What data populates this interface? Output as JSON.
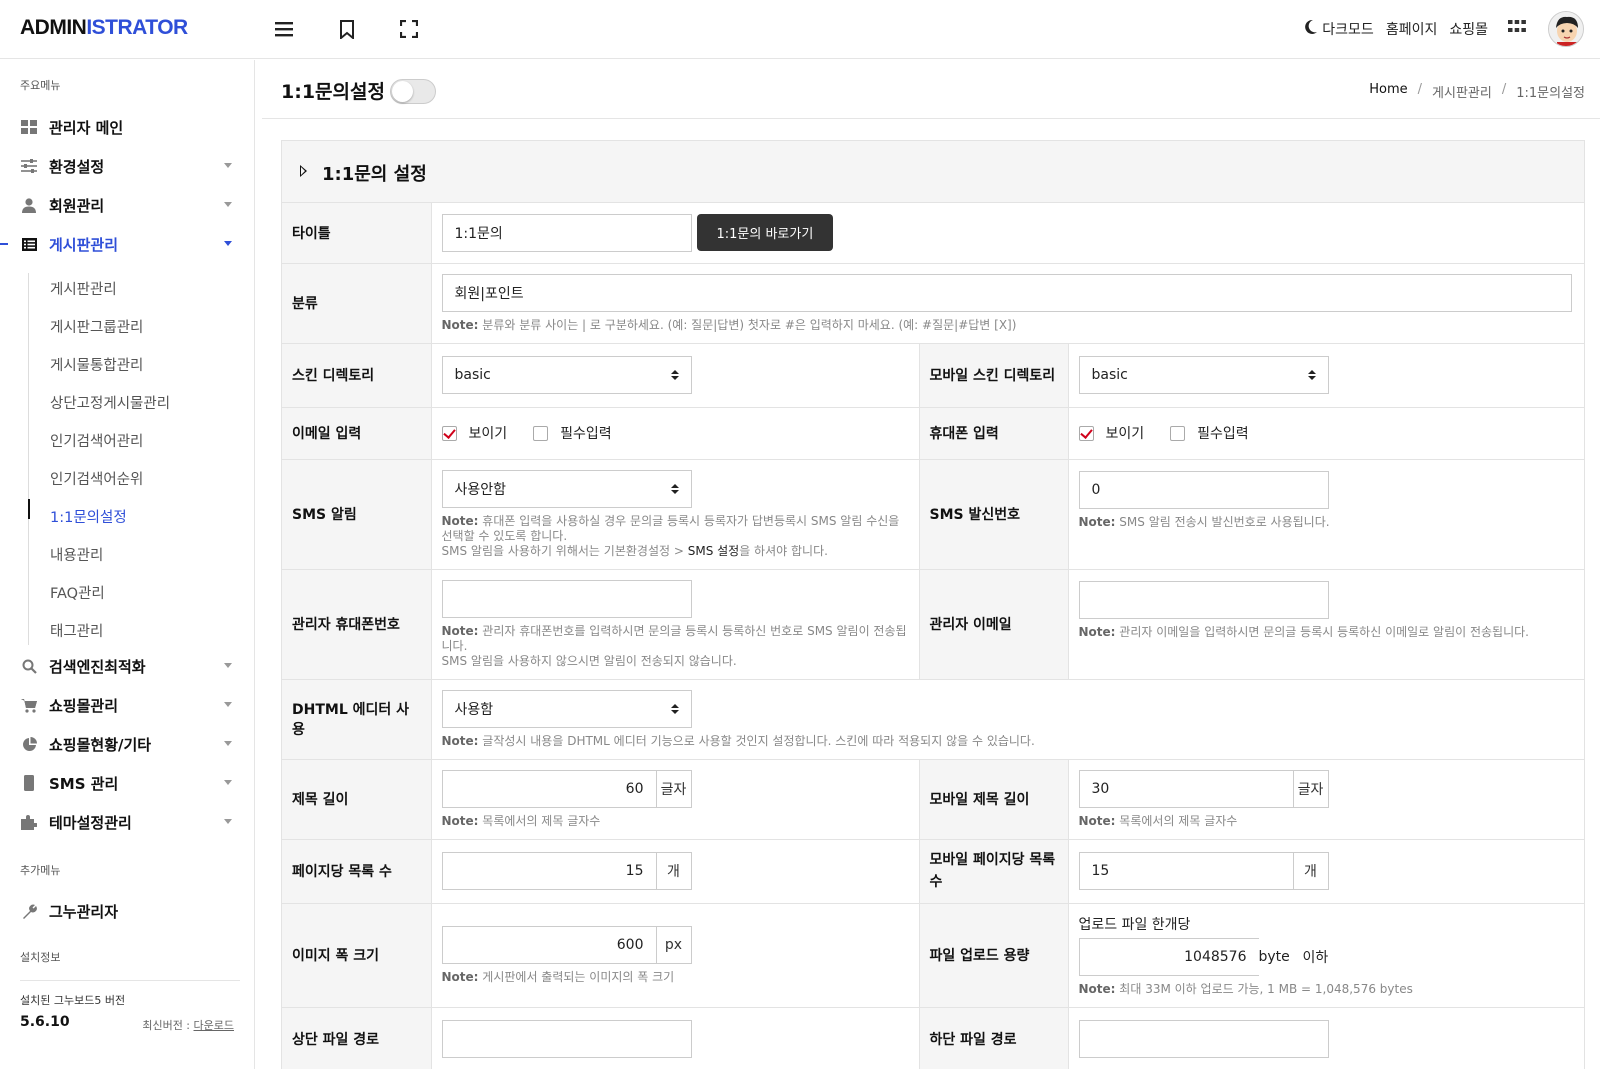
{
  "header": {
    "logo_part1": "ADMIN",
    "logo_part2": "ISTRATOR",
    "dark_mode": "다크모드",
    "homepage": "홈페이지",
    "shop": "쇼핑몰",
    "icons": [
      "menu-icon",
      "bookmark-icon",
      "fullscreen-icon",
      "moon-icon",
      "apps-grid-icon"
    ]
  },
  "sidebar": {
    "section_main": "주요메뉴",
    "items": [
      {
        "label": "관리자 메인",
        "icon": "dashboard-icon"
      },
      {
        "label": "환경설정",
        "icon": "sliders-icon"
      },
      {
        "label": "회원관리",
        "icon": "user-icon"
      },
      {
        "label": "게시판관리",
        "icon": "list-icon"
      },
      {
        "label": "검색엔진최적화",
        "icon": "search-icon"
      },
      {
        "label": "쇼핑몰관리",
        "icon": "cart-icon"
      },
      {
        "label": "쇼핑몰현황/기타",
        "icon": "pie-chart-icon"
      },
      {
        "label": "SMS 관리",
        "icon": "phone-icon"
      },
      {
        "label": "테마설정관리",
        "icon": "puzzle-icon"
      }
    ],
    "sub_items": [
      "게시판관리",
      "게시판그룹관리",
      "게시물통합관리",
      "상단고정게시물관리",
      "인기검색어관리",
      "인기검색어순위",
      "1:1문의설정",
      "내용관리",
      "FAQ관리",
      "태그관리"
    ],
    "section_extra": "추가메뉴",
    "extra_item": "그누관리자",
    "section_install": "설치정보",
    "version_label": "설치된 그누보드5 버전",
    "version": "5.6.10",
    "latest_label": "최신버전 :",
    "latest_link": "다운로드"
  },
  "page": {
    "title": "1:1문의설정",
    "breadcrumb": [
      "Home",
      "게시판관리",
      "1:1문의설정"
    ],
    "panel_title": "1:1문의 설정"
  },
  "form": {
    "title_label": "타이틀",
    "title_value": "1:1문의",
    "title_button": "1:1문의 바로가기",
    "category_label": "분류",
    "category_value": "회원|포인트",
    "category_note_b": "Note:",
    "category_note": "분류와 분류 사이는 | 로 구분하세요. (예: 질문|답변) 첫자로 #은 입력하지 마세요. (예: #질문|#답변 [X])",
    "skin_label": "스킨 디렉토리",
    "skin_value": "basic",
    "mskin_label": "모바일 스킨 디렉토리",
    "mskin_value": "basic",
    "email_label": "이메일 입력",
    "phone_label": "휴대폰 입력",
    "show": "보이기",
    "required": "필수입력",
    "sms_label": "SMS 알림",
    "sms_value": "사용안함",
    "sms_note_b": "Note:",
    "sms_note1": "휴대폰 입력을 사용하실 경우 문의글 등록시 등록자가 답변등록시 SMS 알림 수신을 선택할 수 있도록 합니다.",
    "sms_note2a": "SMS 알림을 사용하기 위해서는 기본환경설정 > ",
    "sms_note2b": "SMS 설정",
    "sms_note2c": "을 하셔야 합니다.",
    "sms_sender_label": "SMS 발신번호",
    "sms_sender_value": "0",
    "sms_sender_note_b": "Note:",
    "sms_sender_note": "SMS 알림 전송시 발신번호로 사용됩니다.",
    "admin_phone_label": "관리자 휴대폰번호",
    "admin_phone_value": "",
    "admin_phone_note_b": "Note:",
    "admin_phone_note1": "관리자 휴대폰번호를 입력하시면 문의글 등록시 등록하신 번호로 SMS 알림이 전송됩니다.",
    "admin_phone_note2": "SMS 알림을 사용하지 않으시면 알림이 전송되지 않습니다.",
    "admin_email_label": "관리자 이메일",
    "admin_email_value": "",
    "admin_email_note_b": "Note:",
    "admin_email_note": "관리자 이메일을 입력하시면 문의글 등록시 등록하신 이메일로 알림이 전송됩니다.",
    "dhtml_label": "DHTML 에디터 사용",
    "dhtml_value": "사용함",
    "dhtml_note_b": "Note:",
    "dhtml_note": "글작성시 내용을 DHTML 에디터 기능으로 사용할 것인지 설정합니다. 스킨에 따라 적용되지 않을 수 있습니다.",
    "subj_len_label": "제목 길이",
    "subj_len_value": "60",
    "subj_len_unit": "글자",
    "subj_len_note_b": "Note:",
    "subj_len_note": "목록에서의 제목 글자수",
    "msubj_len_label": "모바일 제목 길이",
    "msubj_len_value": "30",
    "msubj_len_unit": "글자",
    "msubj_len_note_b": "Note:",
    "msubj_len_note": "목록에서의 제목 글자수",
    "page_rows_label": "페이지당 목록 수",
    "page_rows_value": "15",
    "page_rows_unit": "개",
    "mpage_rows_label": "모바일 페이지당 목록 수",
    "mpage_rows_value": "15",
    "mpage_rows_unit": "개",
    "img_width_label": "이미지 폭 크기",
    "img_width_value": "600",
    "img_width_unit": "px",
    "img_width_note_b": "Note:",
    "img_width_note": "게시판에서 출력되는 이미지의 폭 크기",
    "upload_label": "파일 업로드 용량",
    "upload_caption": "업로드 파일 한개당",
    "upload_value": "1048576",
    "upload_unit": "byte",
    "upload_suffix": "이하",
    "upload_note_b": "Note:",
    "upload_note": "최대 33M 이하 업로드 가능, 1 MB = 1,048,576 bytes",
    "head_file_label": "상단 파일 경로",
    "head_file_value": "",
    "tail_file_label": "하단 파일 경로",
    "tail_file_value": ""
  },
  "colors": {
    "accent": "#2f4fd8",
    "check": "#d0021b",
    "button_dark": "#333333"
  }
}
